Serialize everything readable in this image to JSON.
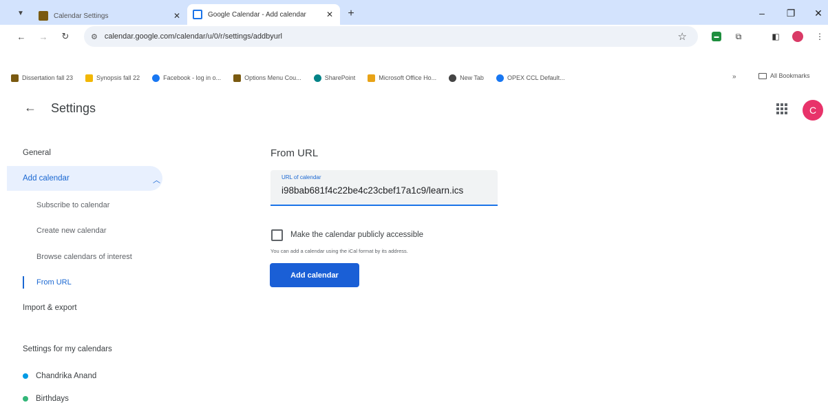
{
  "browser": {
    "tabs": [
      {
        "title": "Calendar Settings",
        "active": false
      },
      {
        "title": "Google Calendar - Add calendar",
        "active": true
      }
    ],
    "new_tab": "+",
    "address": "calendar.google.com/calendar/u/0/r/settings/addbyurl",
    "bookmarks": [
      {
        "label": "Dissertation fall 23",
        "color": "#7a5a10"
      },
      {
        "label": "Synopsis fall 22",
        "color": "#f2b705"
      },
      {
        "label": "Facebook - log in o...",
        "color": "#1877f2"
      },
      {
        "label": "Options Menu Cou...",
        "color": "#7a5a10"
      },
      {
        "label": "SharePoint",
        "color": "#038387"
      },
      {
        "label": "Microsoft Office Ho...",
        "color": "#e8a317"
      },
      {
        "label": "New Tab",
        "color": "#444444"
      },
      {
        "label": "OPEX CCL Default...",
        "color": "#1877f2"
      }
    ],
    "bookmarks_more": "»",
    "all_bookmarks": "All Bookmarks"
  },
  "app": {
    "title": "Settings",
    "avatar_letter": "C",
    "avatar_color": "#e8336a"
  },
  "sidebar": {
    "general": "General",
    "add_calendar": "Add calendar",
    "sub_items": [
      "Subscribe to calendar",
      "Create new calendar",
      "Browse calendars of interest",
      "From URL"
    ],
    "import_export": "Import & export",
    "my_calendars_heading": "Settings for my calendars",
    "calendars": [
      {
        "name": "Chandrika Anand",
        "color": "#039be5"
      },
      {
        "name": "Birthdays",
        "color": "#33b679"
      }
    ]
  },
  "main": {
    "section_title": "From URL",
    "url_label": "URL of calendar",
    "url_value": "i98bab681f4c22be4c23cbef17a1c9/learn.ics",
    "public_checkbox_label": "Make the calendar publicly accessible",
    "public_checked": false,
    "helper_text": "You can add a calendar using the iCal format by its address.",
    "add_button": "Add calendar"
  }
}
